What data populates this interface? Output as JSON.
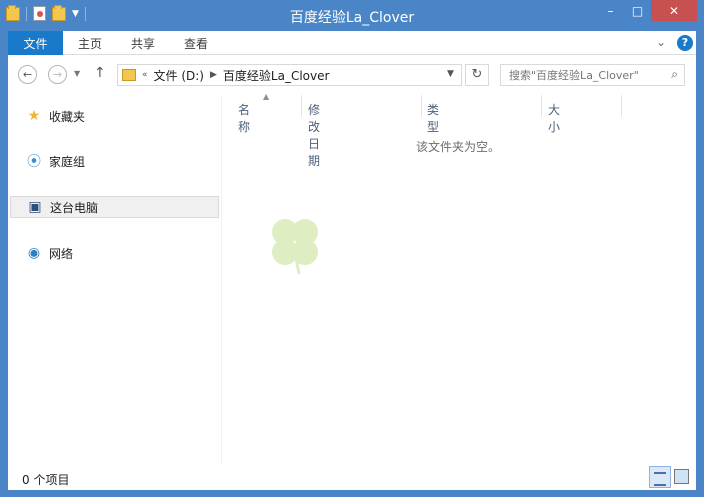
{
  "window": {
    "title": "百度经验La_Clover",
    "minimize": "–",
    "maximize": "□",
    "close": "✕"
  },
  "ribbon": {
    "tabs": [
      "文件",
      "主页",
      "共享",
      "查看"
    ],
    "expand_icon": "chevron-down-icon",
    "help": "?"
  },
  "navigation": {
    "back": "←",
    "forward": "→",
    "up": "↑",
    "address": {
      "crumbs": [
        "文件 (D:)",
        "百度经验La_Clover"
      ],
      "overflow": "«"
    },
    "refresh": "↻",
    "search_placeholder": "搜索\"百度经验La_Clover\""
  },
  "sidebar": {
    "items": [
      {
        "label": "收藏夹",
        "icon": "star-icon"
      },
      {
        "label": "家庭组",
        "icon": "homegroup-icon"
      },
      {
        "label": "这台电脑",
        "icon": "computer-icon",
        "selected": true
      },
      {
        "label": "网络",
        "icon": "network-icon"
      }
    ]
  },
  "file_list": {
    "columns": [
      "名称",
      "修改日期",
      "类型",
      "大小"
    ],
    "empty_message": "该文件夹为空。"
  },
  "status": {
    "items_text": "0 个项目"
  }
}
